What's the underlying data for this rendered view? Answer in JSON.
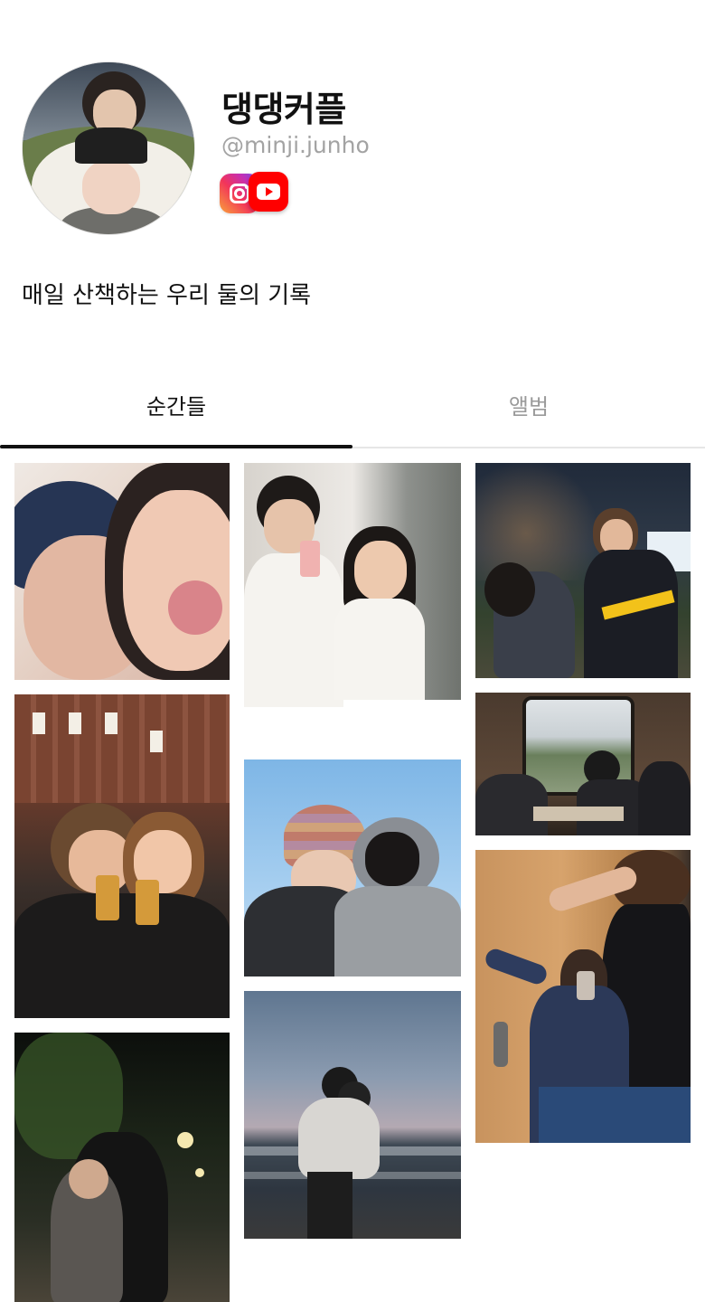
{
  "profile": {
    "name": "댕댕커플",
    "handle": "@minji.junho",
    "bio": "매일 산책하는 우리 둘의 기록",
    "socials": [
      {
        "name": "Instagram",
        "icon": "instagram-icon"
      },
      {
        "name": "YouTube",
        "icon": "youtube-icon"
      }
    ]
  },
  "tabs": [
    {
      "label": "순간들",
      "active": true
    },
    {
      "label": "앨범",
      "active": false
    }
  ],
  "colors": {
    "accent": "#111111",
    "inactive_tab": "#9a9a9a",
    "handle": "#a3a3a3",
    "youtube": "#ff0000"
  },
  "photos": [
    {
      "name": "photo-selfie-kiss",
      "alt": "couple selfie kiss"
    },
    {
      "name": "photo-birthday-mirror",
      "alt": "birthday mirror selfie"
    },
    {
      "name": "photo-night-park",
      "alt": "playful couple at night"
    },
    {
      "name": "photo-city-beer",
      "alt": "couple drinking beer on city street"
    },
    {
      "name": "photo-beanie-sky",
      "alt": "couple in beanies under blue sky"
    },
    {
      "name": "photo-train-window",
      "alt": "couple by train window"
    },
    {
      "name": "photo-beach-piggyback",
      "alt": "piggyback at beach"
    },
    {
      "name": "photo-flex-mirror",
      "alt": "flexing mirror selfie"
    },
    {
      "name": "photo-night-hug",
      "alt": "couple hugging at night"
    }
  ]
}
